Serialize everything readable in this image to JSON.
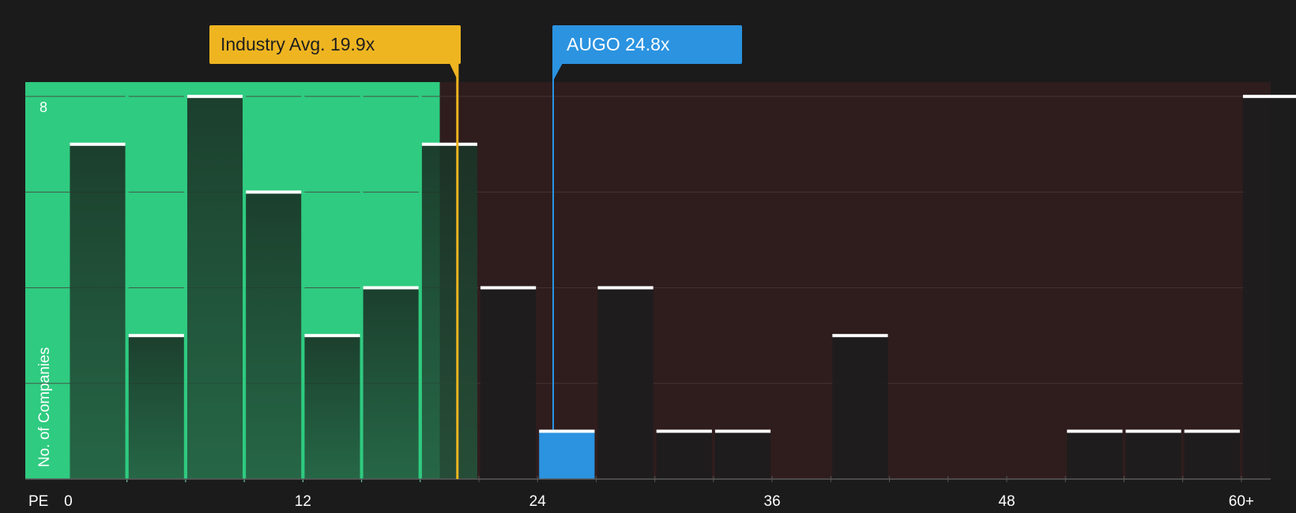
{
  "chart_data": {
    "type": "bar",
    "xlabel": "PE",
    "ylabel": "No. of Companies",
    "bins": [
      {
        "x0": 0,
        "x1": 3,
        "count": 7
      },
      {
        "x0": 3,
        "x1": 6,
        "count": 3
      },
      {
        "x0": 6,
        "x1": 9,
        "count": 8
      },
      {
        "x0": 9,
        "x1": 12,
        "count": 6
      },
      {
        "x0": 12,
        "x1": 15,
        "count": 3
      },
      {
        "x0": 15,
        "x1": 18,
        "count": 4
      },
      {
        "x0": 18,
        "x1": 21,
        "count": 7
      },
      {
        "x0": 21,
        "x1": 24,
        "count": 4
      },
      {
        "x0": 24,
        "x1": 27,
        "count": 1
      },
      {
        "x0": 27,
        "x1": 30,
        "count": 4
      },
      {
        "x0": 30,
        "x1": 33,
        "count": 1
      },
      {
        "x0": 33,
        "x1": 36,
        "count": 1
      },
      {
        "x0": 36,
        "x1": 39,
        "count": 0
      },
      {
        "x0": 39,
        "x1": 42,
        "count": 3
      },
      {
        "x0": 42,
        "x1": 45,
        "count": 0
      },
      {
        "x0": 45,
        "x1": 48,
        "count": 0
      },
      {
        "x0": 48,
        "x1": 51,
        "count": 0
      },
      {
        "x0": 51,
        "x1": 54,
        "count": 1
      },
      {
        "x0": 54,
        "x1": 57,
        "count": 1
      },
      {
        "x0": 57,
        "x1": 60,
        "count": 1
      },
      {
        "x0": 60,
        "x1": 63,
        "count": 8
      }
    ],
    "xlim": [
      -2.2,
      61.5
    ],
    "ylim": [
      0,
      8.3
    ],
    "x_ticks": [
      0,
      12,
      24,
      36,
      48,
      60
    ],
    "x_tick_labels": [
      "0",
      "12",
      "24",
      "36",
      "48",
      "60+"
    ],
    "y_tick_labels": [
      {
        "value": 8,
        "label": "8"
      }
    ],
    "gridlines_y": [
      2,
      4,
      6,
      8
    ],
    "industry_avg": {
      "label": "Industry Avg.",
      "value": 19.9,
      "value_label": "19.9x"
    },
    "stock": {
      "ticker": "AUGO",
      "value": 24.8,
      "value_label": "24.8x",
      "bin_index": 8
    },
    "green_zone_upper": 19,
    "colors": {
      "background": "#1b1b1b",
      "green_zone": "#2fcb80",
      "red_zone": "#2f1d1e",
      "bar_dark": "#1d1d1d",
      "bar_cap": "#ffffff",
      "industry": "#efb521",
      "stock": "#2b93e0",
      "grid": "#4a3a3a"
    }
  }
}
